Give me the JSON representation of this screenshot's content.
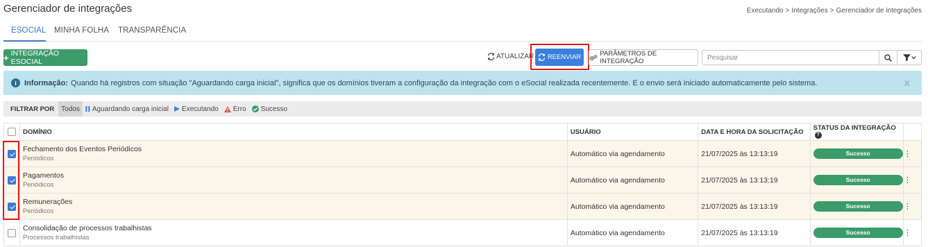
{
  "page": {
    "title": "Gerenciador de integrações",
    "breadcrumb": [
      "Executando",
      "Integrações",
      "Gerenciador de integrações"
    ],
    "breadcrumb_sep": ">"
  },
  "tabs": [
    {
      "label": "ESOCIAL",
      "active": true
    },
    {
      "label": "MINHA FOLHA",
      "active": false
    },
    {
      "label": "TRANSPARÊNCIA",
      "active": false
    }
  ],
  "toolbar": {
    "add_label": "INTEGRAÇÃO ESOCIAL",
    "refresh_label": "ATUALIZAR",
    "resend_label": "REENVIAR",
    "params_label": "PARÂMETROS DE INTEGRAÇÃO",
    "search_placeholder": "Pesquisar"
  },
  "info": {
    "title": "Informação:",
    "text": "Quando há registros com situação \"Aguardando carga inicial\", significa que os domínios tiveram a configuração da integração com o eSocial realizada recentemente. E o envio será iniciado automaticamente pelo sistema.",
    "close": "x"
  },
  "filters": {
    "label": "FILTRAR POR",
    "options": [
      {
        "label": "Todos",
        "active": true,
        "icon": "none"
      },
      {
        "label": "Aguardando carga inicial",
        "icon": "pause-icon",
        "color": "#3a80db"
      },
      {
        "label": "Executando",
        "icon": "play-icon",
        "color": "#3a80db"
      },
      {
        "label": "Erro",
        "icon": "warning-icon",
        "color": "#d9534f"
      },
      {
        "label": "Sucesso",
        "icon": "check-circle-icon",
        "color": "#3b9b6a"
      }
    ]
  },
  "table": {
    "columns": [
      "DOMÍNIO",
      "USUÁRIO",
      "DATA E HORA DA SOLICITAÇÃO",
      "STATUS DA INTEGRAÇÃO"
    ],
    "rows": [
      {
        "name": "Fechamento dos Eventos Periódicos",
        "sub": "Periódicos",
        "user": "Automático via agendamento",
        "datetime": "21/07/2025 às 13:13:19",
        "status": "Sucesso",
        "checked": true
      },
      {
        "name": "Pagamentos",
        "sub": "Periódicos",
        "user": "Automático via agendamento",
        "datetime": "21/07/2025 às 13:13:19",
        "status": "Sucesso",
        "checked": true
      },
      {
        "name": "Remunerações",
        "sub": "Periódicos",
        "user": "Automático via agendamento",
        "datetime": "21/07/2025 às 13:13:19",
        "status": "Sucesso",
        "checked": true
      },
      {
        "name": "Consolidação de processos trabalhistas",
        "sub": "Processos trabalhistas",
        "user": "Automático via agendamento",
        "datetime": "21/07/2025 às 13:13:19",
        "status": "Sucesso",
        "checked": false
      }
    ]
  },
  "colors": {
    "primary": "#3a80db",
    "success": "#3b9b6a",
    "info_bg": "#bde3ef",
    "highlight_outline": "#e0161b",
    "selected_row": "#fbf6ea"
  }
}
